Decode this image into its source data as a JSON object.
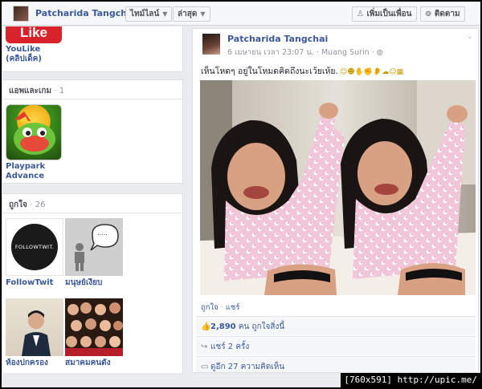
{
  "topbar": {
    "profile_name": "Patcharida Tangchai",
    "timeline_label": "ไทม์ไลน์",
    "latest_label": "ล่าสุด",
    "add_friend_label": "เพิ่มเป็นเพื่อน",
    "follow_label": "ติดตาม"
  },
  "left": {
    "youlike": {
      "logo_text": "Like",
      "label": "YouLike (คลิปเด็ค)"
    },
    "apps": {
      "title": "แอพและเกม",
      "count": "· 1",
      "items": [
        {
          "label": "Playpark Advance"
        }
      ]
    },
    "likes": {
      "title": "ถูกใจ",
      "count": "· 26",
      "items": [
        {
          "label": "FollowTwit",
          "logo_text": "FOLLOWTWIT."
        },
        {
          "label": "มนุษย์เงียบ",
          "bubble_text": "....."
        },
        {
          "label": "ห้องปกครอง"
        },
        {
          "label": "สมาคมคนดัง"
        }
      ]
    }
  },
  "post": {
    "author": "Patcharida Tangchai",
    "meta": "6 เมษายน เวลา 23:07 น. · Muang Surin ·",
    "text": "เห็นโหดๆ อยู่ในโหมดคิดถึงนะเว้ยเห้ย.",
    "like_action": "ถูกใจ",
    "share_action": "แชร์",
    "likes_count": "2,890",
    "likes_text": "คน ถูกใจสิ่งนี้",
    "shares_text": "แชร์ 2 ครั้ง",
    "comments_text": "ดูอีก 27 ความคิดเห็น"
  },
  "watermark": "[760x591] http://upic.me/",
  "colors": {
    "link": "#3b5998",
    "bar": "#f6f7f9",
    "border": "#dddfe2"
  }
}
